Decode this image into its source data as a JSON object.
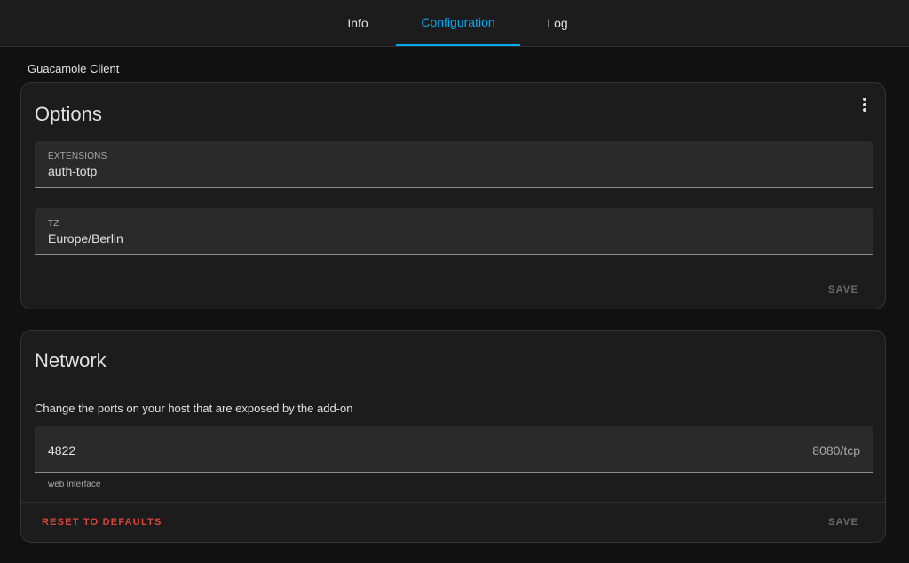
{
  "tabs": [
    {
      "label": "Info",
      "active": false
    },
    {
      "label": "Configuration",
      "active": true
    },
    {
      "label": "Log",
      "active": false
    }
  ],
  "addon": {
    "name": "Guacamole Client"
  },
  "options": {
    "title": "Options",
    "menu_icon": "dots-vertical-icon",
    "fields": [
      {
        "label": "EXTENSIONS",
        "value": "auth-totp"
      },
      {
        "label": "TZ",
        "value": "Europe/Berlin"
      }
    ],
    "save_label": "SAVE"
  },
  "network": {
    "title": "Network",
    "description": "Change the ports on your host that are exposed by the add-on",
    "port": {
      "value": "4822",
      "suffix": "8080/tcp",
      "helper": "web interface"
    },
    "reset_label": "RESET TO DEFAULTS",
    "save_label": "SAVE"
  },
  "colors": {
    "accent": "#03a9f4",
    "danger": "#db4437",
    "card_bg": "#1c1c1c",
    "page_bg": "#111111"
  }
}
